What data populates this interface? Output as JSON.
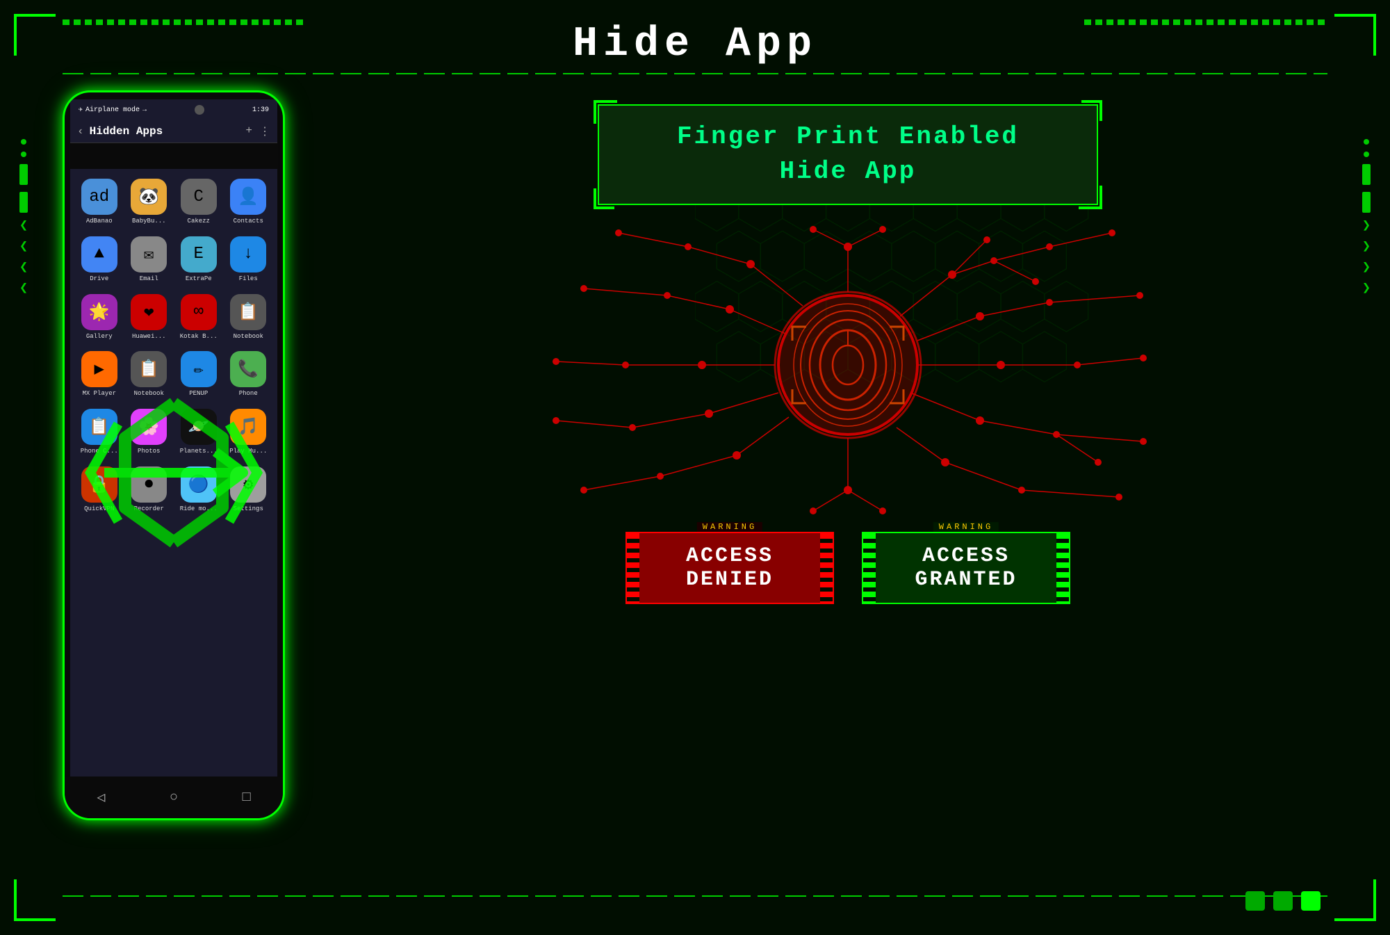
{
  "page": {
    "title": "Hide App",
    "background_color": "#010e01"
  },
  "header": {
    "title": "Hide App"
  },
  "phone": {
    "status_bar": {
      "left": "Airplane mode",
      "right": "1:39"
    },
    "top_bar": {
      "back": "‹",
      "title": "Hidden Apps",
      "add": "+",
      "menu": "⋮"
    },
    "apps": [
      {
        "label": "AdBanao",
        "color": "#4A90D9",
        "icon": "ad"
      },
      {
        "label": "BabyBu...",
        "color": "#E8A838",
        "icon": "🐼"
      },
      {
        "label": "Cakezz",
        "color": "#888",
        "icon": "C"
      },
      {
        "label": "Contacts",
        "color": "#3B82F6",
        "icon": "👤"
      },
      {
        "label": "Drive",
        "color": "#4285F4",
        "icon": "▲"
      },
      {
        "label": "Email",
        "color": "#888",
        "icon": "✉"
      },
      {
        "label": "ExtraPe",
        "color": "#4AC",
        "icon": "E"
      },
      {
        "label": "Files",
        "color": "#1E88E5",
        "icon": "↓"
      },
      {
        "label": "Gallery",
        "color": "#E040FB",
        "icon": "🌟"
      },
      {
        "label": "Huawei...",
        "color": "#CC0000",
        "icon": "❤"
      },
      {
        "label": "Kotak B...",
        "color": "#CC0000",
        "icon": "∞"
      },
      {
        "label": "Notebook",
        "color": "#555",
        "icon": "📋"
      },
      {
        "label": "MX Player",
        "color": "#FF6900",
        "icon": "▶"
      },
      {
        "label": "Notebook",
        "color": "#555",
        "icon": "📋"
      },
      {
        "label": "PENUP",
        "color": "#1E88E5",
        "icon": "✏"
      },
      {
        "label": "Phone",
        "color": "#4CAF50",
        "icon": "📞"
      },
      {
        "label": "Phone C...",
        "color": "#1E88E5",
        "icon": "📋"
      },
      {
        "label": "Photos",
        "color": "#E040FB",
        "icon": "🌸"
      },
      {
        "label": "Planets...",
        "color": "#111",
        "icon": "🪐"
      },
      {
        "label": "Play Mu...",
        "color": "#FF8A00",
        "icon": "🎵"
      },
      {
        "label": "QuickVPN",
        "color": "#CC3300",
        "icon": "🔒"
      },
      {
        "label": "Recorder",
        "color": "#888",
        "icon": "⏺"
      },
      {
        "label": "Ride mo...",
        "color": "#4FC3F7",
        "icon": "🔵"
      },
      {
        "label": "Settings",
        "color": "#9E9E9E",
        "icon": "⚙"
      }
    ]
  },
  "fingerprint_section": {
    "title_line1": "Finger Print Enabled",
    "title_line2": "Hide App"
  },
  "access_denied": {
    "warning_label": "WARNING",
    "text": "ACCESS\nDENIED"
  },
  "access_granted": {
    "warning_label": "WARNING",
    "text": "ACCESS\nGRANTED"
  },
  "bottom_dots": [
    {
      "active": false
    },
    {
      "active": false
    },
    {
      "active": true
    }
  ],
  "icons": {
    "back_arrow": "◁",
    "home_circle": "○",
    "square": "□",
    "airplane": "✈",
    "fingerprint": "🔒"
  }
}
